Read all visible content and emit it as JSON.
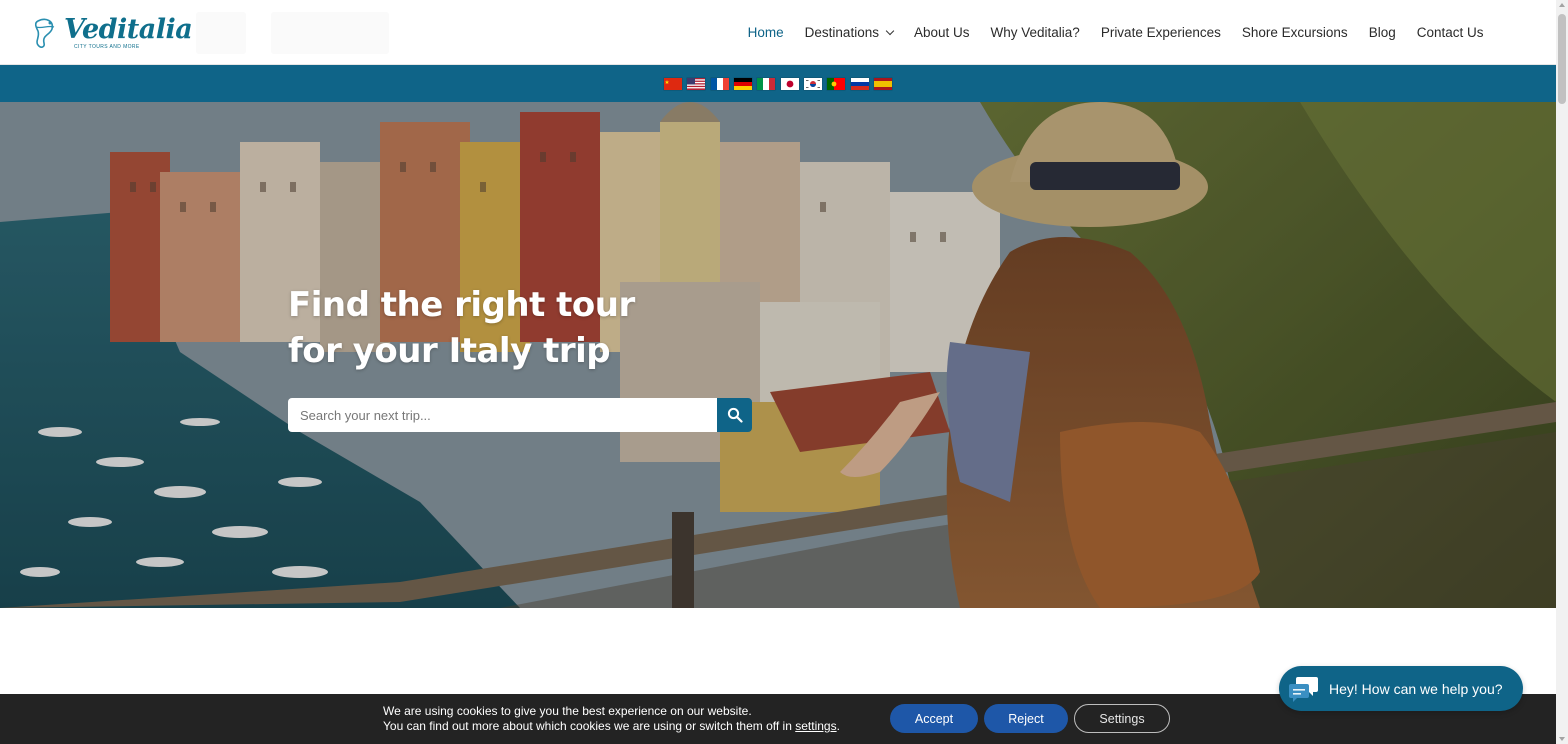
{
  "brand": {
    "name": "Veditalia",
    "tagline": "CITY TOURS AND MORE",
    "color": "#0f6488"
  },
  "nav": {
    "items": [
      {
        "label": "Home",
        "active": true
      },
      {
        "label": "Destinations",
        "has_dropdown": true
      },
      {
        "label": "About Us"
      },
      {
        "label": "Why Veditalia?"
      },
      {
        "label": "Private Experiences"
      },
      {
        "label": "Shore Excursions"
      },
      {
        "label": "Blog"
      },
      {
        "label": "Contact Us"
      }
    ]
  },
  "languages": [
    "flag-china-icon",
    "flag-usa-icon",
    "flag-france-icon",
    "flag-germany-icon",
    "flag-italy-icon",
    "flag-japan-icon",
    "flag-korea-icon",
    "flag-portugal-icon",
    "flag-russia-icon",
    "flag-spain-icon"
  ],
  "hero": {
    "title_line1": "Find the right tour",
    "title_line2": "for your Italy trip",
    "search_placeholder": "Search your next trip...",
    "search_icon": "search-icon"
  },
  "chat": {
    "label": "Hey! How can we help you?",
    "icon": "chat-bubble-icon"
  },
  "cookie": {
    "line1": "We are using cookies to give you the best experience on our website.",
    "line2_prefix": "You can find out more about which cookies we are using or switch them off in ",
    "line2_link": "settings",
    "line2_suffix": ".",
    "accept_label": "Accept",
    "reject_label": "Reject",
    "settings_label": "Settings"
  }
}
